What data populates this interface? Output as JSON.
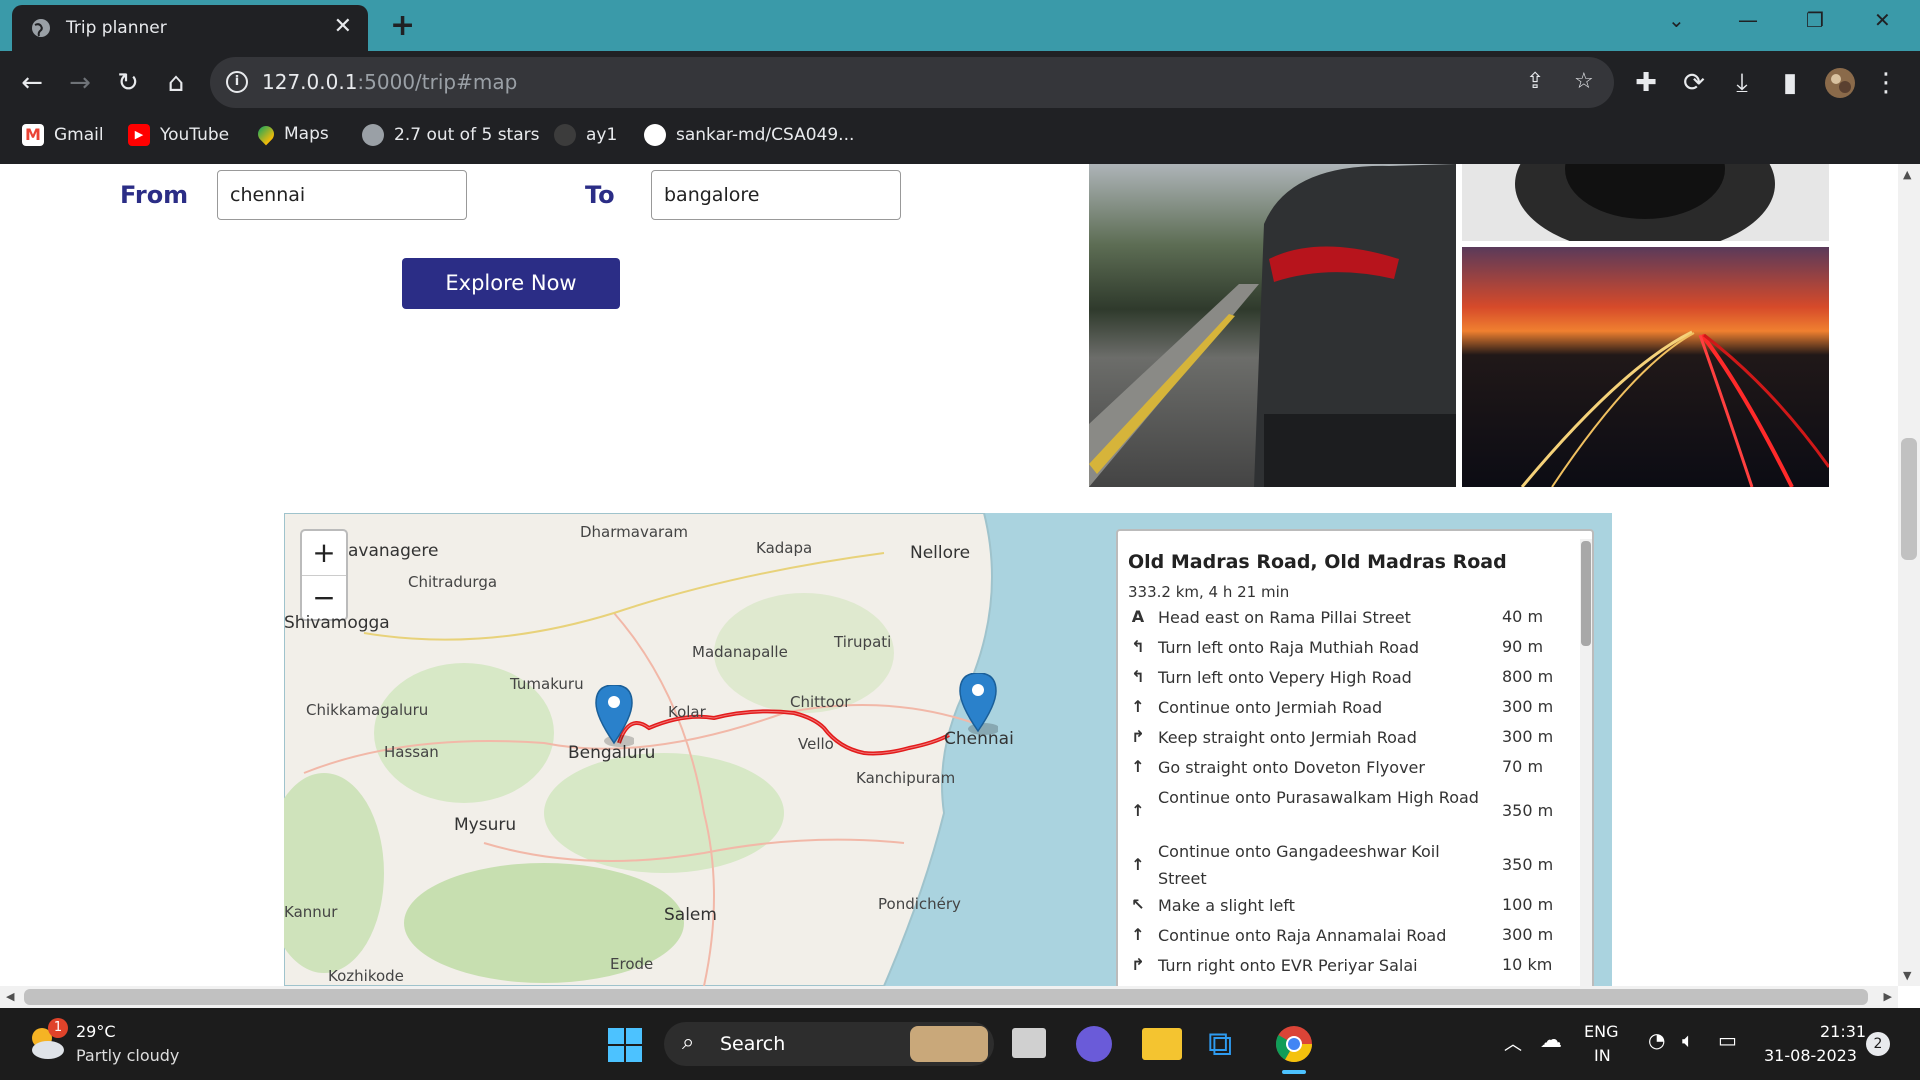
{
  "browser": {
    "tab_title": "Trip planner",
    "url_host": "127.0.0.1",
    "url_rest": ":5000/trip#map",
    "bookmarks": [
      "Gmail",
      "YouTube",
      "Maps",
      "2.7 out of 5 stars",
      "ay1",
      "sankar-md/CSA049..."
    ]
  },
  "form": {
    "from_label": "From",
    "from_value": "chennai",
    "to_label": "To",
    "to_value": "bangalore",
    "explore_label": "Explore Now"
  },
  "map": {
    "zoom_in": "+",
    "zoom_out": "−",
    "cities": {
      "davanagere": "avanagere",
      "chitradurga": "Chitradurga",
      "shivamogga": "Shivamogga",
      "dharmavaram": "Dharmavaram",
      "kadapa": "Kadapa",
      "nellore": "Nellore",
      "tirupati": "Tirupati",
      "madanapalle": "Madanapalle",
      "tumakuru": "Tumakuru",
      "chikkamagaluru": "Chikkamagaluru",
      "hassan": "Hassan",
      "kolar": "Kolar",
      "chittoor": "Chittoor",
      "vellore": "Vello",
      "chennai": "Chennai",
      "bengaluru": "Bengaluru",
      "kanchipuram": "Kanchipuram",
      "mysuru": "Mysuru",
      "kannur": "Kannur",
      "salem": "Salem",
      "pondichery": "Pondichéry",
      "kozhikode": "Kozhikode",
      "erode": "Erode"
    }
  },
  "route": {
    "title": "Old Madras Road, Old Madras Road",
    "summary": "333.2 km, 4 h 21 min",
    "steps": [
      {
        "icon": "A",
        "text": "Head east on Rama Pillai Street",
        "dist": "40 m"
      },
      {
        "icon": "↰",
        "text": "Turn left onto Raja Muthiah Road",
        "dist": "90 m"
      },
      {
        "icon": "↰",
        "text": "Turn left onto Vepery High Road",
        "dist": "800 m"
      },
      {
        "icon": "↑",
        "text": "Continue onto Jermiah Road",
        "dist": "300 m"
      },
      {
        "icon": "↱",
        "text": "Keep straight onto Jermiah Road",
        "dist": "300 m"
      },
      {
        "icon": "↑",
        "text": "Go straight onto Doveton Flyover",
        "dist": "70 m"
      },
      {
        "icon": "↑",
        "text": "Continue onto Purasawalkam High Road",
        "dist": "350 m"
      },
      {
        "icon": "↑",
        "text": "Continue onto Gangadeeshwar Koil Street",
        "dist": "350 m"
      },
      {
        "icon": "↖",
        "text": "Make a slight left",
        "dist": "100 m"
      },
      {
        "icon": "↑",
        "text": "Continue onto Raja Annamalai Road",
        "dist": "300 m"
      },
      {
        "icon": "↱",
        "text": "Turn right onto EVR Periyar Salai",
        "dist": "10 km"
      }
    ]
  },
  "taskbar": {
    "temp": "29°C",
    "weather": "Partly cloudy",
    "badge": "1",
    "search": "Search",
    "lang1": "ENG",
    "lang2": "IN",
    "time": "21:31",
    "date": "31-08-2023",
    "notif": "2"
  }
}
